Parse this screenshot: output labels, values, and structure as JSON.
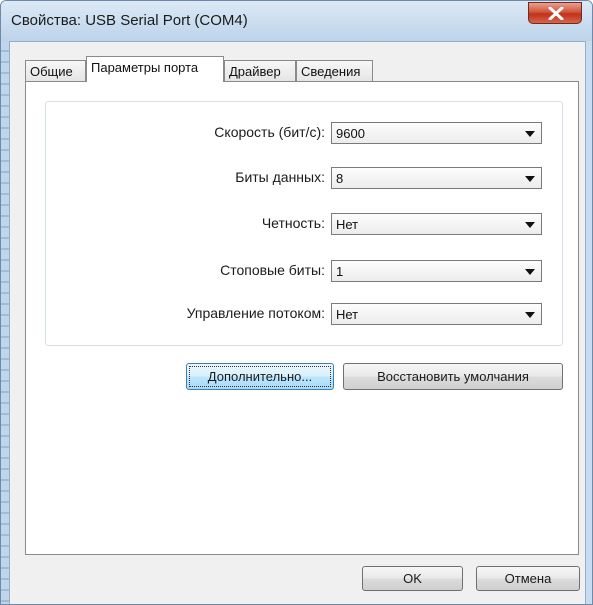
{
  "window": {
    "title": "Свойства: USB Serial Port (COM4)",
    "close_icon": "close-x-icon"
  },
  "tabs": [
    {
      "label": "Общие",
      "active": false
    },
    {
      "label": "Параметры порта",
      "active": true
    },
    {
      "label": "Драйвер",
      "active": false
    },
    {
      "label": "Сведения",
      "active": false
    }
  ],
  "settings": [
    {
      "label": "Скорость (бит/с):",
      "value": "9600"
    },
    {
      "label": "Биты данных:",
      "value": "8"
    },
    {
      "label": "Четность:",
      "value": "Нет"
    },
    {
      "label": "Стоповые биты:",
      "value": "1"
    },
    {
      "label": "Управление потоком:",
      "value": "Нет"
    }
  ],
  "buttons": {
    "advanced": "Дополнительно...",
    "restore_defaults": "Восстановить умолчания",
    "ok": "OK",
    "cancel": "Отмена"
  },
  "colors": {
    "frame": "#c9dcef",
    "close_button": "#c0311a",
    "focused_button": "#bee6fd"
  }
}
